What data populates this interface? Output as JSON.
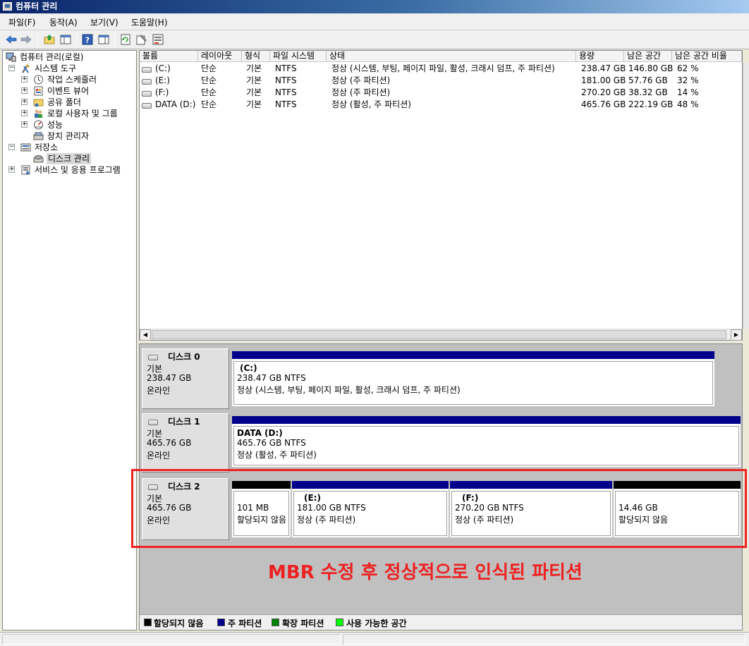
{
  "window": {
    "title": "컴퓨터 관리"
  },
  "menu": [
    "파일(F)",
    "동작(A)",
    "보기(V)",
    "도움말(H)"
  ],
  "toolbar": {
    "icons": [
      "back-arrow-icon",
      "forward-arrow-icon",
      "up-folder-icon",
      "show-hide-tree-icon",
      "help-icon",
      "show-hide-action-pane-icon",
      "refresh-icon",
      "properties-icon",
      "export-icon"
    ]
  },
  "tree": {
    "root": "컴퓨터 관리(로컬)",
    "system_tools": "시스템 도구",
    "task_scheduler": "작업 스케줄러",
    "event_viewer": "이벤트 뷰어",
    "shared_folders": "공유 폴더",
    "local_users": "로컬 사용자 및 그룹",
    "performance": "성능",
    "device_manager": "장치 관리자",
    "storage": "저장소",
    "disk_management": "디스크 관리",
    "services": "서비스 및 응용 프로그램",
    "expand_plus": "+",
    "expand_minus": "−"
  },
  "volume_list": {
    "headers": [
      "볼륨",
      "레이아웃",
      "형식",
      "파일 시스템",
      "상태",
      "용량",
      "남은 공간",
      "남은 공간 비율"
    ],
    "rows": [
      [
        "(C:)",
        "단순",
        "기본",
        "NTFS",
        "정상 (시스템, 부팅, 페이지 파일, 활성, 크래시 덤프, 주 파티션)",
        "238.47 GB",
        "146.80 GB",
        "62 %"
      ],
      [
        "(E:)",
        "단순",
        "기본",
        "NTFS",
        "정상 (주 파티션)",
        "181.00 GB",
        "57.76 GB",
        "32 %"
      ],
      [
        "(F:)",
        "단순",
        "기본",
        "NTFS",
        "정상 (주 파티션)",
        "270.20 GB",
        "38.32 GB",
        "14 %"
      ],
      [
        "DATA (D:)",
        "단순",
        "기본",
        "NTFS",
        "정상 (활성, 주 파티션)",
        "465.76 GB",
        "222.19 GB",
        "48 %"
      ]
    ],
    "scroll_left": "◀",
    "scroll_right": "▶"
  },
  "disks": [
    {
      "title": "디스크 0",
      "type": "기본",
      "size": "238.47 GB",
      "status": "온라인",
      "partitions": [
        {
          "name": "(C:)",
          "line1": "238.47 GB NTFS",
          "line2": "정상 (시스템, 부팅, 페이지 파일, 활성, 크래시 덤프, 주 파티션)",
          "kind": "primary"
        }
      ]
    },
    {
      "title": "디스크 1",
      "type": "기본",
      "size": "465.76 GB",
      "status": "온라인",
      "partitions": [
        {
          "name": "DATA  (D:)",
          "line1": "465.76 GB NTFS",
          "line2": "정상 (활성, 주 파티션)",
          "kind": "primary"
        }
      ]
    },
    {
      "title": "디스크 2",
      "type": "기본",
      "size": "465.76 GB",
      "status": "온라인",
      "partitions": [
        {
          "name": "",
          "line1": "101 MB",
          "line2": "할당되지 않음",
          "kind": "unallocated"
        },
        {
          "name": "(E:)",
          "line1": "181.00 GB NTFS",
          "line2": "정상 (주 파티션)",
          "kind": "primary"
        },
        {
          "name": "(F:)",
          "line1": "270.20 GB NTFS",
          "line2": "정상 (주 파티션)",
          "kind": "primary"
        },
        {
          "name": "",
          "line1": "14.46 GB",
          "line2": "할당되지 않음",
          "kind": "unallocated"
        }
      ]
    }
  ],
  "legend": [
    {
      "label": "할당되지 않음",
      "color": "#000000"
    },
    {
      "label": "주 파티션",
      "color": "#00008b"
    },
    {
      "label": "확장 파티션",
      "color": "#008000"
    },
    {
      "label": "사용 가능한 공간",
      "color": "#00ff00"
    }
  ],
  "annotation": {
    "text": "MBR 수정 후 정상적으로 인식된 파티션",
    "color": "#ee2121"
  },
  "colors": {
    "primary": "#00008b",
    "unallocated": "#000000",
    "title_bar": "#0a246a"
  }
}
